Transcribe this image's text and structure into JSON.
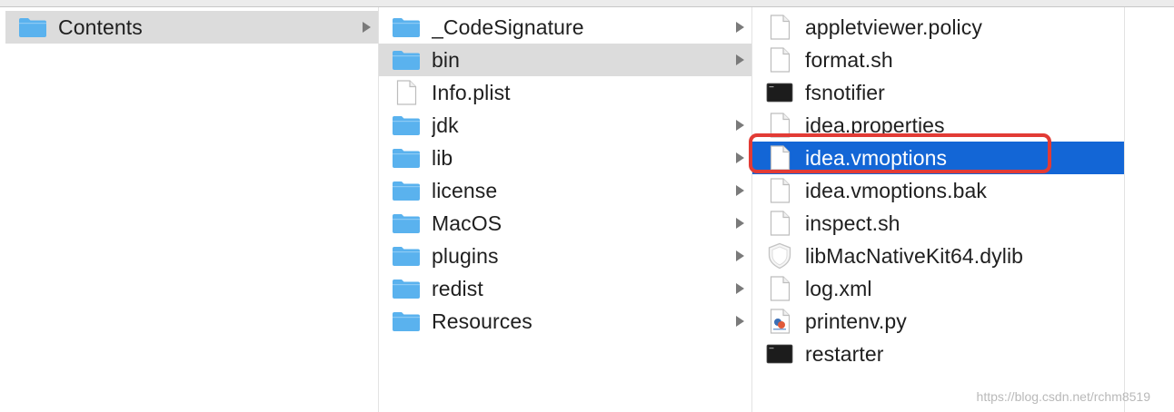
{
  "colors": {
    "accent": "#1366d6",
    "annotation": "#e23b35",
    "folder": "#5ab2ee",
    "selection_gray": "#dcdcdc"
  },
  "columns": [
    {
      "items": [
        {
          "label": "Contents",
          "icon": "folder-icon",
          "has_children": true,
          "state": "selected-inactive"
        }
      ]
    },
    {
      "items": [
        {
          "label": "_CodeSignature",
          "icon": "folder-icon",
          "has_children": true
        },
        {
          "label": "bin",
          "icon": "folder-icon",
          "has_children": true,
          "state": "selected-inactive"
        },
        {
          "label": "Info.plist",
          "icon": "document-icon",
          "has_children": false
        },
        {
          "label": "jdk",
          "icon": "folder-icon",
          "has_children": true
        },
        {
          "label": "lib",
          "icon": "folder-icon",
          "has_children": true
        },
        {
          "label": "license",
          "icon": "folder-icon",
          "has_children": true
        },
        {
          "label": "MacOS",
          "icon": "folder-icon",
          "has_children": true
        },
        {
          "label": "plugins",
          "icon": "folder-icon",
          "has_children": true
        },
        {
          "label": "redist",
          "icon": "folder-icon",
          "has_children": true
        },
        {
          "label": "Resources",
          "icon": "folder-icon",
          "has_children": true
        }
      ]
    },
    {
      "items": [
        {
          "label": "appletviewer.policy",
          "icon": "document-icon"
        },
        {
          "label": "format.sh",
          "icon": "document-icon"
        },
        {
          "label": "fsnotifier",
          "icon": "terminal-executable-icon"
        },
        {
          "label": "idea.properties",
          "icon": "document-icon"
        },
        {
          "label": "idea.vmoptions",
          "icon": "document-icon",
          "state": "selected-active"
        },
        {
          "label": "idea.vmoptions.bak",
          "icon": "document-icon"
        },
        {
          "label": "inspect.sh",
          "icon": "document-icon"
        },
        {
          "label": "libMacNativeKit64.dylib",
          "icon": "library-shield-icon"
        },
        {
          "label": "log.xml",
          "icon": "document-icon"
        },
        {
          "label": "printenv.py",
          "icon": "python-script-icon"
        },
        {
          "label": "restarter",
          "icon": "terminal-executable-icon"
        }
      ]
    }
  ],
  "watermark": "https://blog.csdn.net/rchm8519"
}
